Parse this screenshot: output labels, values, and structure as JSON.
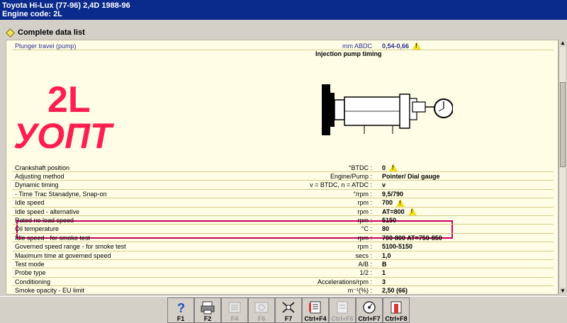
{
  "titlebar": {
    "make": "Toyota",
    "model": "Hi-Lux (77-96) 2,4D",
    "years": "1988-96",
    "engine_code": "Engine code: 2L"
  },
  "section": {
    "title": "Complete data list"
  },
  "top_row": {
    "label": "Plunger travel (pump)",
    "unit": "mm ABDC",
    "value": "0,54-0,66"
  },
  "diagram_title": "Injection pump timing",
  "overlay": {
    "line1": "2L",
    "line2": "УОПТ"
  },
  "rows": [
    {
      "label": "Crankshaft position",
      "unit": "°BTDC",
      "value": "0",
      "warn": true
    },
    {
      "label": "Adjusting method",
      "unit": "Engine/Pump",
      "value": "Pointer/ Dial gauge",
      "warn": false
    },
    {
      "label": "Dynamic timing",
      "unit": "v = BTDC, n = ATDC",
      "value": "v",
      "warn": false
    },
    {
      "label": "- Time Trac Stanadyne, Snap-on",
      "unit": "°/rpm",
      "value": "9,5/790",
      "warn": false
    },
    {
      "label": "Idle speed",
      "unit": "rpm",
      "value": "700",
      "warn": true
    },
    {
      "label": "Idle speed - alternative",
      "unit": "rpm",
      "value": "AT=800",
      "warn": true
    },
    {
      "label": "Rated no load speed",
      "unit": "rpm",
      "value": "5150",
      "warn": false
    },
    {
      "label": "Oil temperature",
      "unit": "°C",
      "value": "80",
      "warn": false
    },
    {
      "label": "Idle speed - for smoke test",
      "unit": "rpm",
      "value": "700-800 AT=750-850",
      "warn": false
    },
    {
      "label": "Governed speed range - for smoke test",
      "unit": "rpm",
      "value": "5100-5150",
      "warn": false
    },
    {
      "label": "Maximum time at governed speed",
      "unit": "secs",
      "value": "1,0",
      "warn": false
    },
    {
      "label": "Test mode",
      "unit": "A/B",
      "value": "B",
      "warn": false
    },
    {
      "label": "Probe type",
      "unit": "1/2",
      "value": "1",
      "warn": false
    },
    {
      "label": "Conditioning",
      "unit": "Accelerations/rpm",
      "value": "3",
      "warn": false
    },
    {
      "label": "Smoke opacity - EU limit",
      "unit": "m⁻¹(%)",
      "value": "2,50 (66)",
      "warn": false
    }
  ],
  "function_keys": [
    {
      "label": "F1",
      "icon": "help-icon",
      "disabled": false
    },
    {
      "label": "F2",
      "icon": "printer-icon",
      "disabled": false
    },
    {
      "label": "F4",
      "icon": "list-icon",
      "disabled": true
    },
    {
      "label": "F6",
      "icon": "graphic-icon",
      "disabled": true
    },
    {
      "label": "F7",
      "icon": "tools-icon",
      "disabled": false
    },
    {
      "label": "Ctrl+F4",
      "icon": "notes-icon",
      "disabled": false
    },
    {
      "label": "Ctrl+F6",
      "icon": "doc-icon",
      "disabled": true
    },
    {
      "label": "Ctrl+F7",
      "icon": "gauge-icon",
      "disabled": false
    },
    {
      "label": "Ctrl+F8",
      "icon": "exit-icon",
      "disabled": false
    }
  ],
  "colors": {
    "title_bg": "#0a2a8c",
    "panel_bg": "#fffde6",
    "overlay_red": "#ff1f4f",
    "highlight": "#c8005e",
    "warning": "#f2df20"
  }
}
